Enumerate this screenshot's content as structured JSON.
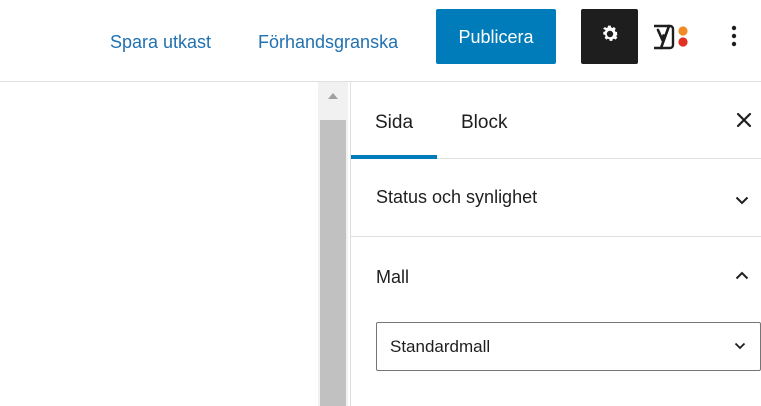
{
  "toolbar": {
    "save_draft_label": "Spara utkast",
    "preview_label": "Förhandsgranska",
    "publish_label": "Publicera",
    "settings_icon": "gear-icon",
    "yoast_icon": "yoast-seo-icon",
    "more_icon": "vertical-ellipsis-icon"
  },
  "sidebar": {
    "tabs": [
      {
        "label": "Sida",
        "active": true
      },
      {
        "label": "Block",
        "active": false
      }
    ],
    "close_icon": "close-icon",
    "panels": [
      {
        "title": "Status och synlighet",
        "expanded": false
      },
      {
        "title": "Mall",
        "expanded": true
      }
    ],
    "template_select": {
      "value": "Standardmall"
    }
  },
  "colors": {
    "accent": "#007cba",
    "link": "#2271b1",
    "dark": "#1e1e1e",
    "border": "#e0e0e0",
    "yoast_red": "#e1301f",
    "yoast_orange": "#f08a24"
  }
}
